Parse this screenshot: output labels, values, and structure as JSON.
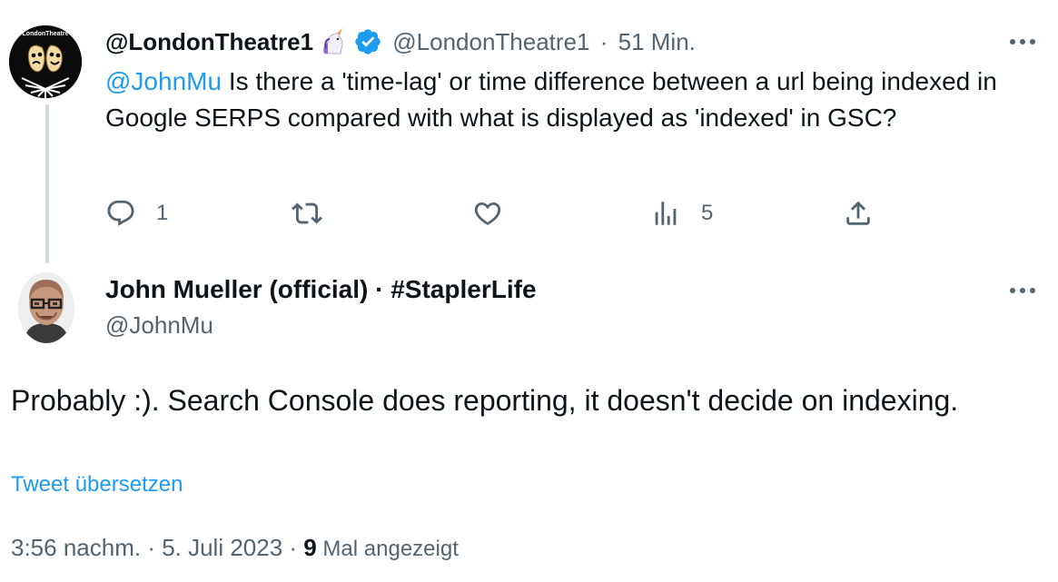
{
  "tweet1": {
    "author_name": "@LondonTheatre1",
    "handle": "@LondonTheatre1",
    "separator": "·",
    "time": "51 Min.",
    "mention": "@JohnMu",
    "text": " Is there a 'time-lag' or time difference between a url being indexed in Google SERPS compared with what is displayed as 'indexed' in GSC?",
    "avatar_text": "LondonTheatre",
    "actions": {
      "reply_count": "1",
      "retweet_count": "",
      "like_count": "",
      "views_count": "5"
    },
    "icons": [
      "unicorn-emoji",
      "verified-badge-icon",
      "more-icon",
      "reply-icon",
      "retweet-icon",
      "like-icon",
      "views-icon",
      "share-icon"
    ]
  },
  "tweet2": {
    "author_name": "John Mueller (official) · #StaplerLife",
    "handle": "@JohnMu",
    "text": "Probably :). Search Console does reporting, it doesn't decide on indexing.",
    "translate_link": "Tweet übersetzen",
    "timestamp": "3:56 nachm. · 5. Juli 2023 · ",
    "views_number": "9",
    "views_label": " Mal angezeigt"
  },
  "colors": {
    "text": "#0f1419",
    "muted": "#536471",
    "link": "#1d9bf0",
    "thread_line": "#cfd9de",
    "verified": "#1d9bf0"
  }
}
